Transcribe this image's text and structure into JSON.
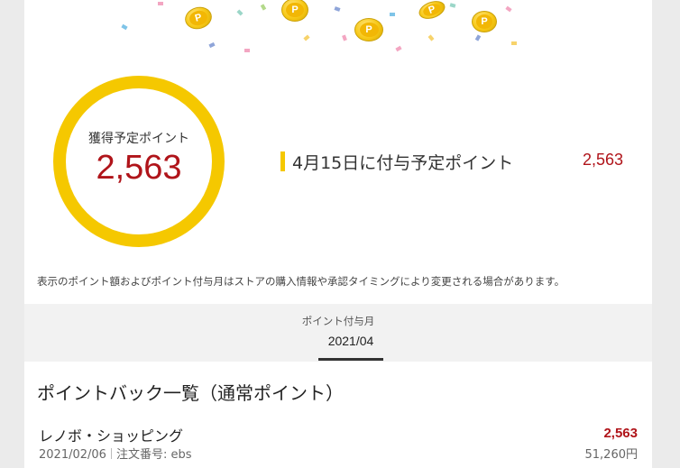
{
  "coin_glyph": "P",
  "summary": {
    "ring_label": "獲得予定ポイント",
    "ring_value": "2,563",
    "grant_label": "4月15日に付与予定ポイント",
    "grant_value": "2,563"
  },
  "notice": "表示のポイント額およびポイント付与月はストアの購入情報や承認タイミングにより変更される場合があります。",
  "month_selector": {
    "caption": "ポイント付与月",
    "selected_month": "2021/04"
  },
  "list": {
    "title": "ポイントバック一覧（通常ポイント）",
    "items": [
      {
        "shop": "レノボ・ショッピング",
        "date": "2021/02/06",
        "order_label": "注文番号: ebs",
        "points": "2,563",
        "price": "51,260円"
      }
    ]
  },
  "colors": {
    "accent_yellow": "#f5c800",
    "points_red": "#b0141a"
  }
}
